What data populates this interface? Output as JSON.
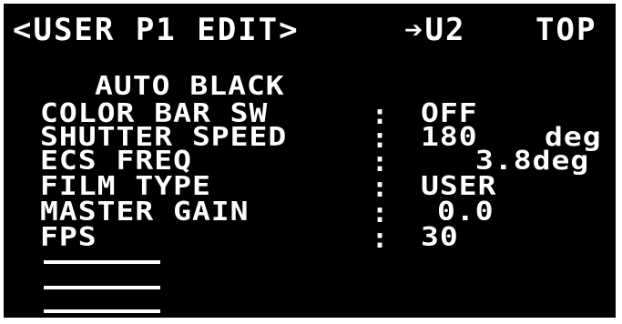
{
  "header": {
    "title": "<USER P1 EDIT>",
    "next_page": "➔U2",
    "top_link": "TOP"
  },
  "menu": {
    "heading": "AUTO BLACK",
    "rows": [
      {
        "label": "COLOR BAR SW",
        "colon": ":",
        "value": "OFF",
        "unit": ""
      },
      {
        "label": "SHUTTER SPEED",
        "colon": ":",
        "value": "180",
        "unit": "deg"
      },
      {
        "label": "ECS FREQ",
        "colon": ":",
        "value": "3.8deg",
        "unit": ""
      },
      {
        "label": "FILM TYPE",
        "colon": ":",
        "value": "USER",
        "unit": ""
      },
      {
        "label": "MASTER GAIN",
        "colon": ":",
        "value": "0.0",
        "unit": ""
      },
      {
        "label": "FPS",
        "colon": ":",
        "value": "30",
        "unit": ""
      }
    ],
    "empty_slots": [
      "-----",
      "-----",
      "-----"
    ]
  }
}
